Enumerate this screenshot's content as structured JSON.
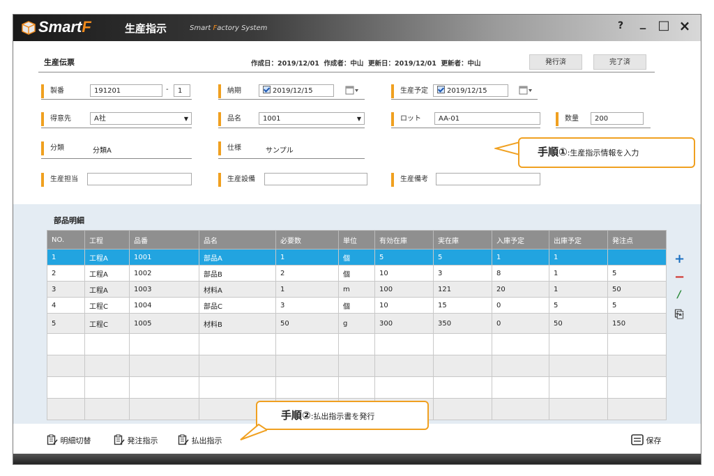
{
  "app": {
    "logo_main": "Smart",
    "logo_f": "F",
    "title": "生産指示",
    "subtitle_a": "Smart ",
    "subtitle_f": "F",
    "subtitle_b": "actory System",
    "help_icon": "?",
    "minimize_icon": "_",
    "maximize_icon": "□",
    "close_icon": "×"
  },
  "header": {
    "section_title": "生産伝票",
    "meta": "作成日：2019/12/01  作成者：中山  更新日：2019/12/01  更新者：中山",
    "issued_button": "発行済",
    "completed_button": "完了済"
  },
  "form": {
    "seiban_label": "製番",
    "seiban_value": "191201",
    "seiban_dash": "-",
    "seiban_sub": "1",
    "nouki_label": "納期",
    "nouki_value": "2019/12/15",
    "plan_label": "生産予定",
    "plan_value": "2019/12/15",
    "customer_label": "得意先",
    "customer_value": "A社",
    "product_label": "品名",
    "product_value": "1001",
    "lot_label": "ロット",
    "lot_value": "AA-01",
    "qty_label": "数量",
    "qty_value": "200",
    "category_label": "分類",
    "category_value": "分類A",
    "spec_label": "仕様",
    "spec_value": "サンプル",
    "staff_label": "生産担当",
    "staff_value": "",
    "equipment_label": "生産設備",
    "equipment_value": "",
    "note_label": "生産備考",
    "note_value": ""
  },
  "parts": {
    "title": "部品明細",
    "columns": [
      "NO.",
      "工程",
      "品番",
      "品名",
      "必要数",
      "単位",
      "有効在庫",
      "実在庫",
      "入庫予定",
      "出庫予定",
      "発注点"
    ],
    "rows": [
      [
        "1",
        "工程A",
        "1001",
        "部品A",
        "1",
        "個",
        "5",
        "5",
        "1",
        "1",
        ""
      ],
      [
        "2",
        "工程A",
        "1002",
        "部品B",
        "2",
        "個",
        "10",
        "3",
        "8",
        "1",
        "5"
      ],
      [
        "3",
        "工程A",
        "1003",
        "材料A",
        "1",
        "m",
        "100",
        "121",
        "20",
        "1",
        "50"
      ],
      [
        "4",
        "工程C",
        "1004",
        "部品C",
        "3",
        "個",
        "10",
        "15",
        "0",
        "5",
        "5"
      ],
      [
        "5",
        "工程C",
        "1005",
        "材料B",
        "50",
        "g",
        "300",
        "350",
        "0",
        "50",
        "150"
      ]
    ],
    "add_icon": "+",
    "remove_icon": "−",
    "edit_icon": "/",
    "copy_icon": "⎘"
  },
  "callouts": {
    "step1_big": "手順①",
    "step1_text": ":生産指示情報を入力",
    "step2_big": "手順②",
    "step2_text": ":払出指示書を発行"
  },
  "toolbar": {
    "detail_switch": "明細切替",
    "order_instruction": "発注指示",
    "dispatch_instruction": "払出指示",
    "save": "保存"
  },
  "colors": {
    "accent": "#f0a020",
    "selected_row": "#22a4e0",
    "header_bg": "#8f8f8f",
    "panel_bg": "#e4ecf3",
    "add_icon": "#1a6fc0",
    "remove_icon": "#d0302a",
    "edit_icon": "#2a8a3a"
  }
}
